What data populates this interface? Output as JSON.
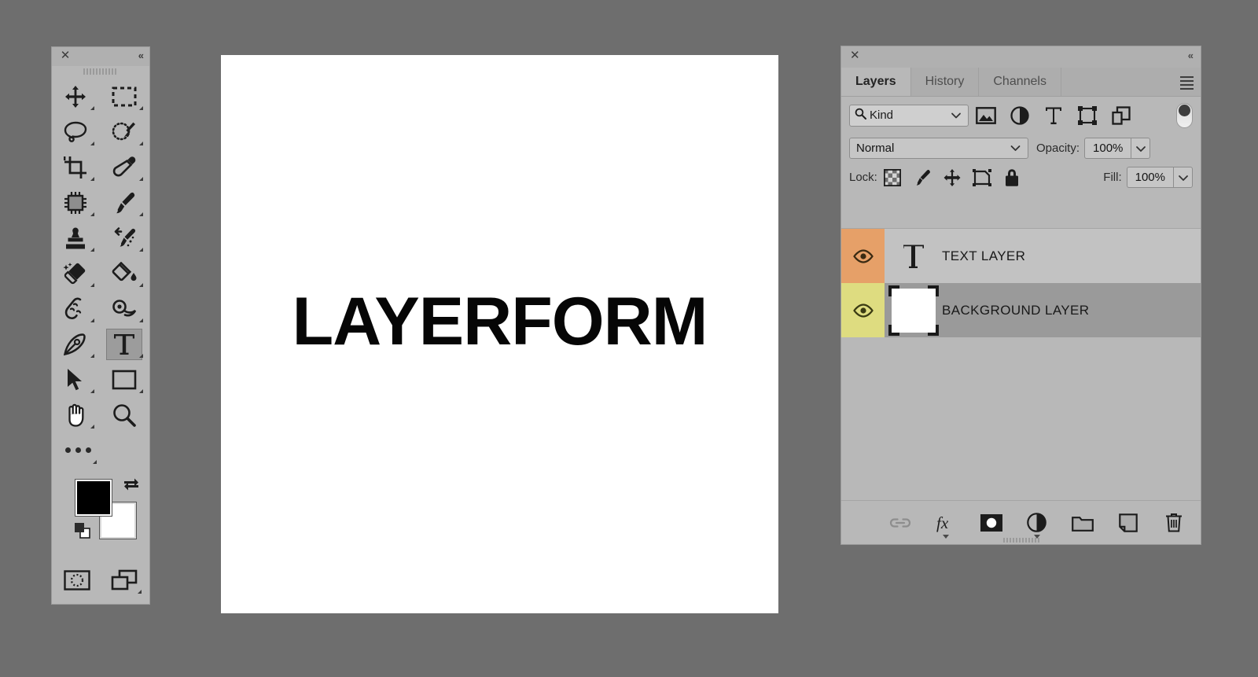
{
  "app": {
    "background_color": "#6e6e6e"
  },
  "toolbar": {
    "close_label": "✕",
    "collapse_label": "«",
    "grip_name": "drag-grip",
    "tools": [
      {
        "name": "move-tool",
        "icon": "move",
        "has_corner": true,
        "active": false
      },
      {
        "name": "rectangular-marquee-tool",
        "icon": "marquee",
        "has_corner": true,
        "active": false
      },
      {
        "name": "lasso-tool",
        "icon": "lasso",
        "has_corner": true,
        "active": false
      },
      {
        "name": "quick-selection-tool",
        "icon": "quick-select",
        "has_corner": true,
        "active": false
      },
      {
        "name": "crop-tool",
        "icon": "crop",
        "has_corner": true,
        "active": false
      },
      {
        "name": "eyedropper-tool",
        "icon": "eyedropper",
        "has_corner": true,
        "active": false
      },
      {
        "name": "spot-healing-brush-tool",
        "icon": "healing",
        "has_corner": true,
        "active": false
      },
      {
        "name": "brush-tool",
        "icon": "brush",
        "has_corner": true,
        "active": false
      },
      {
        "name": "clone-stamp-tool",
        "icon": "stamp",
        "has_corner": true,
        "active": false
      },
      {
        "name": "history-brush-tool",
        "icon": "history-brush",
        "has_corner": true,
        "active": false
      },
      {
        "name": "eraser-tool",
        "icon": "eraser",
        "has_corner": true,
        "active": false
      },
      {
        "name": "paint-bucket-tool",
        "icon": "bucket",
        "has_corner": true,
        "active": false
      },
      {
        "name": "blur-tool",
        "icon": "smudge",
        "has_corner": true,
        "active": false
      },
      {
        "name": "dodge-tool",
        "icon": "dodge",
        "has_corner": true,
        "active": false
      },
      {
        "name": "pen-tool",
        "icon": "pen",
        "has_corner": true,
        "active": false
      },
      {
        "name": "type-tool",
        "icon": "type",
        "has_corner": true,
        "active": true
      },
      {
        "name": "path-selection-tool",
        "icon": "path-select",
        "has_corner": true,
        "active": false
      },
      {
        "name": "rectangle-tool",
        "icon": "rectangle",
        "has_corner": true,
        "active": false
      },
      {
        "name": "hand-tool",
        "icon": "hand",
        "has_corner": true,
        "active": false
      },
      {
        "name": "zoom-tool",
        "icon": "zoom",
        "has_corner": false,
        "active": false
      }
    ],
    "more_tools_name": "edit-toolbar-button",
    "foreground_color": "#000000",
    "background_color": "#ffffff",
    "swap_colors_name": "swap-colors-button",
    "default_colors_name": "default-colors-button",
    "quick_mask_name": "quick-mask-mode-button",
    "screen_mode_name": "screen-mode-button"
  },
  "canvas": {
    "text": "LAYERFORM",
    "paper_color": "#ffffff"
  },
  "panel": {
    "close_label": "✕",
    "collapse_label": "«",
    "menu_name": "panel-menu-button",
    "tabs": [
      {
        "label": "Layers",
        "active": true
      },
      {
        "label": "History",
        "active": false
      },
      {
        "label": "Channels",
        "active": false
      }
    ],
    "filter": {
      "kind_label": "Kind",
      "icons": [
        {
          "name": "filter-pixel-layers-icon",
          "icon": "image"
        },
        {
          "name": "filter-adjustment-layers-icon",
          "icon": "adjustment"
        },
        {
          "name": "filter-type-layers-icon",
          "icon": "type"
        },
        {
          "name": "filter-shape-layers-icon",
          "icon": "shape"
        },
        {
          "name": "filter-smart-objects-icon",
          "icon": "smart-object"
        }
      ],
      "toggle_name": "filter-enable-toggle"
    },
    "blend": {
      "mode": "Normal",
      "opacity_label": "Opacity:",
      "opacity_value": "100%"
    },
    "lock": {
      "label": "Lock:",
      "icons": [
        {
          "name": "lock-transparent-pixels-icon",
          "icon": "checker"
        },
        {
          "name": "lock-image-pixels-icon",
          "icon": "brush"
        },
        {
          "name": "lock-position-icon",
          "icon": "move"
        },
        {
          "name": "lock-artboard-nesting-icon",
          "icon": "artboard"
        },
        {
          "name": "lock-all-icon",
          "icon": "lock"
        }
      ],
      "fill_label": "Fill:",
      "fill_value": "100%"
    },
    "layers": [
      {
        "name": "TEXT LAYER",
        "type": "text",
        "visible": true,
        "selected": false,
        "swatch_color": "#e6a068",
        "thumb_color": null
      },
      {
        "name": "BACKGROUND LAYER",
        "type": "image",
        "visible": true,
        "selected": true,
        "swatch_color": "#dedc80",
        "thumb_color": "#ffffff"
      }
    ],
    "footer": [
      {
        "name": "link-layers-button",
        "icon": "link",
        "caret": false,
        "disabled": true
      },
      {
        "name": "layer-style-button",
        "icon": "fx",
        "caret": true,
        "disabled": false
      },
      {
        "name": "add-layer-mask-button",
        "icon": "mask",
        "caret": false,
        "disabled": false
      },
      {
        "name": "new-adjustment-layer-button",
        "icon": "adjustment",
        "caret": true,
        "disabled": false
      },
      {
        "name": "new-group-button",
        "icon": "folder",
        "caret": false,
        "disabled": false
      },
      {
        "name": "new-layer-button",
        "icon": "new-layer",
        "caret": false,
        "disabled": false
      },
      {
        "name": "delete-layer-button",
        "icon": "trash",
        "caret": false,
        "disabled": false
      }
    ]
  }
}
